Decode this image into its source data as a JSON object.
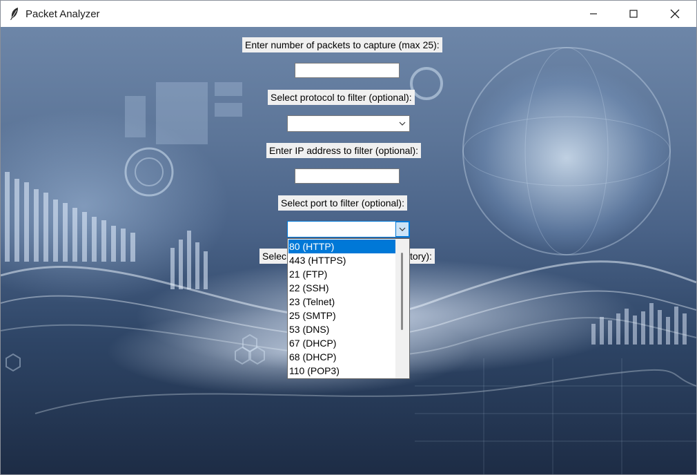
{
  "window": {
    "title": "Packet Analyzer",
    "icon": "feather-icon",
    "controls": [
      "minimize-icon",
      "maximize-icon",
      "close-icon"
    ]
  },
  "form": {
    "packets_label": "Enter number of packets to capture (max 25):",
    "packets_value": "",
    "protocol_label": "Select protocol to filter (optional):",
    "protocol_value": "",
    "ip_label": "Enter IP address to filter (optional):",
    "ip_value": "",
    "port_label": "Select port to filter (optional):",
    "port_value": "",
    "hidden_label_left": "Selec",
    "hidden_label_right": "tory):"
  },
  "port_dropdown": {
    "selected_index": 0,
    "options": [
      "80 (HTTP)",
      "443 (HTTPS)",
      "21 (FTP)",
      "22 (SSH)",
      "23 (Telnet)",
      "25 (SMTP)",
      "53 (DNS)",
      "67 (DHCP)",
      "68 (DHCP)",
      "110 (POP3)"
    ]
  },
  "colors": {
    "selection": "#0078d7",
    "label_bg": "#f0f0f0"
  }
}
